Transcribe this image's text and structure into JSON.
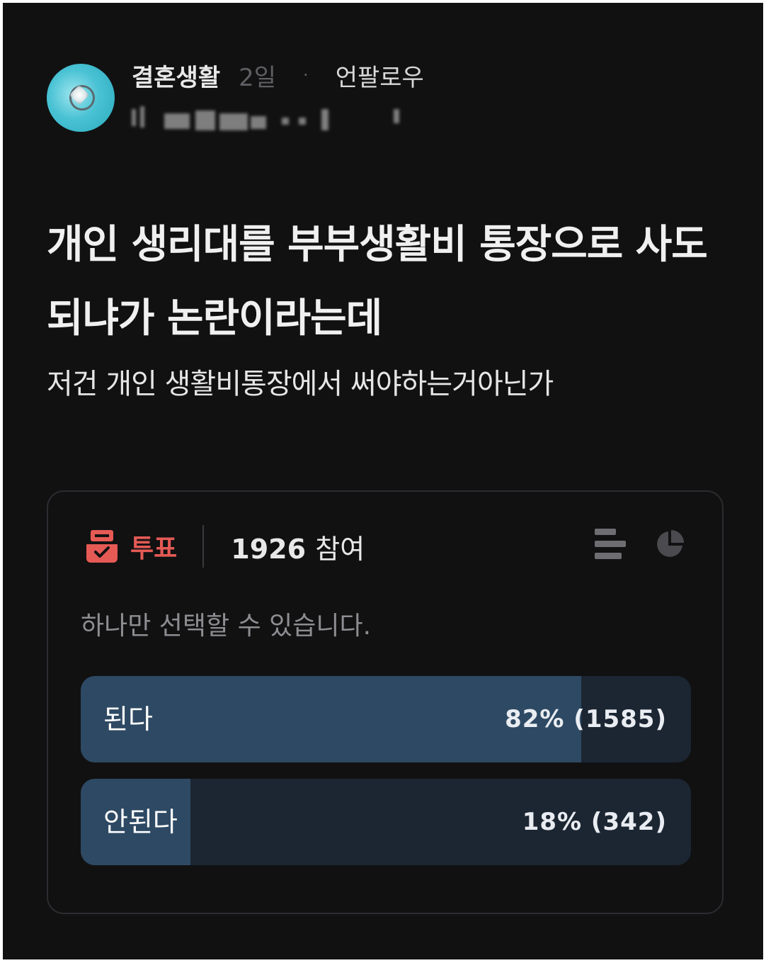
{
  "post": {
    "community": "결혼생활",
    "time": "2일",
    "separator": "·",
    "author_status": "언팔로우",
    "title": "개인 생리대를 부부생활비 통장으로 사도 되냐가 논란이라는데",
    "body": "저건 개인 생활비통장에서 써야하는거아닌가"
  },
  "poll": {
    "label": "투표",
    "participants_count": "1926",
    "participants_unit": "참여",
    "hint": "하나만 선택할 수 있습니다.",
    "options": [
      {
        "label": "된다",
        "stat": "82% (1585)",
        "percent": 82
      },
      {
        "label": "안된다",
        "stat": "18% (342)",
        "percent": 18
      }
    ]
  },
  "colors": {
    "background": "#111112",
    "accent_red": "#e55a55",
    "bar_fill": "#2e4963",
    "bar_track": "#1c2633"
  },
  "icons": [
    "ballot-box-icon",
    "bar-list-icon",
    "pie-chart-icon"
  ]
}
